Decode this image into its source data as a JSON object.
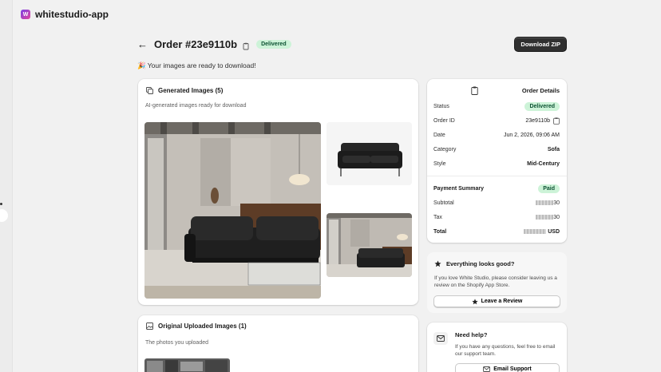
{
  "app": {
    "logo_letter": "W",
    "name": "whitestudio-app",
    "accent": "#7b3fe4"
  },
  "order": {
    "title": "Order #23e9110b",
    "status_badge": "Delivered",
    "download_label": "Download ZIP",
    "ready_message": "🎉 Your images are ready to download!"
  },
  "generated": {
    "title": "Generated Images (5)",
    "subtitle": "AI-generated images ready for download"
  },
  "original": {
    "title": "Original Uploaded Images (1)",
    "subtitle": "The photos you uploaded"
  },
  "order_details": {
    "title": "Order Details",
    "rows": [
      {
        "label": "Status",
        "value": "Delivered"
      },
      {
        "label": "Order ID",
        "value": "23e9110b"
      },
      {
        "label": "Date",
        "value": "Jun 2, 2026, 09:06 AM"
      },
      {
        "label": "Category",
        "value": "Sofa"
      },
      {
        "label": "Style",
        "value": "Mid-Century"
      }
    ],
    "payment": {
      "title": "Payment Summary",
      "badge": "Paid",
      "subtotal_label": "Subtotal",
      "subtotal_suffix": "30",
      "tax_label": "Tax",
      "tax_suffix": "30",
      "total_label": "Total",
      "total_suffix": "USD"
    }
  },
  "feedback": {
    "title": "Everything looks good?",
    "text": "If you love White Studio, please consider leaving us a review on the Shopify App Store.",
    "button": "Leave a Review"
  },
  "help": {
    "title": "Need help?",
    "text": "If you have any questions, feel free to email our support team.",
    "button": "Email Support"
  },
  "colors": {
    "badge_bg": "#cdf3d8",
    "badge_text": "#0c5132",
    "primary_button": "#303030"
  }
}
